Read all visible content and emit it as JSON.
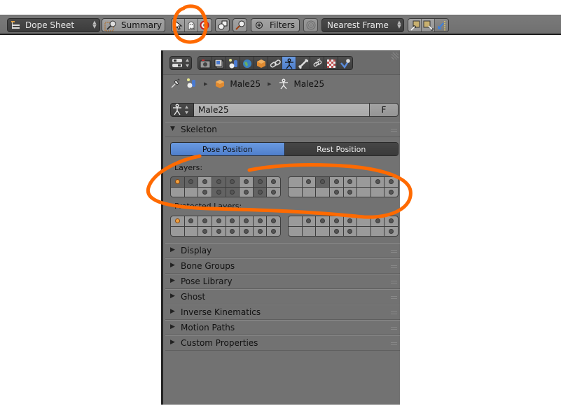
{
  "toolbar": {
    "editor_type": {
      "icon": "dopesheet-icon",
      "label": "Dope Sheet"
    },
    "summary": {
      "icon": "summary-icon",
      "label": "Summary"
    },
    "selection_modes": [
      {
        "icon": "cursor-icon",
        "active": false
      },
      {
        "icon": "ghost-icon",
        "active": false
      },
      {
        "icon": "lifebuoy-icon",
        "active": false
      }
    ],
    "only_selected_icon": "shapes-icon",
    "search_icon": "magnifier-icon",
    "filters": {
      "icon": "plus-circle-icon",
      "label": "Filters"
    },
    "proportional_icon": "proportional-icon",
    "snap": {
      "label": "Nearest Frame"
    },
    "keyframe_tools": [
      "copy-keys-icon",
      "paste-keys-icon",
      "paste-flipped-icon"
    ]
  },
  "properties": {
    "context_switch_icon": "editor-type-icon",
    "tabs": [
      {
        "icon": "render-icon",
        "active": false
      },
      {
        "icon": "render-layers-icon",
        "active": false
      },
      {
        "icon": "scene-icon",
        "active": false
      },
      {
        "icon": "world-icon",
        "active": false
      },
      {
        "icon": "object-icon",
        "active": false
      },
      {
        "icon": "constraints-icon",
        "active": false
      },
      {
        "icon": "armature-data-icon",
        "active": true
      },
      {
        "icon": "bone-icon",
        "active": false
      },
      {
        "icon": "bone-constraints-icon",
        "active": false
      },
      {
        "icon": "texture-icon",
        "active": false
      },
      {
        "icon": "physics-icon",
        "active": false
      }
    ],
    "breadcrumb": {
      "pin_icon": "pin-icon",
      "scene_icon": "scene-icon",
      "object": {
        "icon": "object-icon",
        "label": "Male25"
      },
      "armature": {
        "icon": "armature-icon",
        "label": "Male25"
      }
    },
    "armature_field": {
      "value": "Male25",
      "fake_user_label": "F"
    },
    "skeleton": {
      "title": "Skeleton",
      "expanded": true,
      "pose_position_label": "Pose Position",
      "rest_position_label": "Rest Position",
      "selected_position": "Pose Position",
      "layers_label": "Layers:",
      "protected_layers_label": "Protected Layers:",
      "layers": {
        "left": {
          "on": [
            [
              1,
              1,
              0,
              1,
              1,
              0,
              1,
              0
            ],
            [
              0,
              0,
              0,
              1,
              1,
              0,
              1,
              0
            ]
          ],
          "dots": [
            [
              2,
              1,
              1,
              1,
              1,
              1,
              1,
              1
            ],
            [
              0,
              0,
              1,
              1,
              1,
              1,
              1,
              1
            ]
          ]
        },
        "right": {
          "on": [
            [
              0,
              0,
              1,
              0,
              0,
              0,
              0,
              0
            ],
            [
              0,
              0,
              0,
              0,
              0,
              0,
              0,
              0
            ]
          ],
          "dots": [
            [
              0,
              1,
              1,
              1,
              1,
              0,
              1,
              1
            ],
            [
              0,
              0,
              0,
              1,
              1,
              0,
              0,
              1
            ]
          ]
        }
      },
      "protected_layers": {
        "left": {
          "on": [
            [
              0,
              0,
              0,
              0,
              0,
              0,
              0,
              0
            ],
            [
              0,
              0,
              0,
              0,
              0,
              0,
              0,
              0
            ]
          ],
          "dots": [
            [
              2,
              1,
              1,
              1,
              1,
              1,
              1,
              1
            ],
            [
              0,
              0,
              1,
              1,
              1,
              1,
              1,
              1
            ]
          ]
        },
        "right": {
          "on": [
            [
              0,
              0,
              0,
              0,
              0,
              0,
              0,
              0
            ],
            [
              0,
              0,
              0,
              0,
              0,
              0,
              0,
              0
            ]
          ],
          "dots": [
            [
              0,
              1,
              1,
              1,
              1,
              0,
              1,
              1
            ],
            [
              0,
              0,
              0,
              1,
              1,
              0,
              0,
              1
            ]
          ]
        }
      }
    },
    "collapsed_sections": [
      "Display",
      "Bone Groups",
      "Pose Library",
      "Ghost",
      "Inverse Kinematics",
      "Motion Paths",
      "Custom Properties"
    ]
  },
  "annotations": {
    "color": "#ff6a00",
    "items": [
      "circle-around-ghost-button",
      "ellipse-around-layers"
    ]
  },
  "colors": {
    "panel_bg": "#727272",
    "active_blue": "#5b8ad6",
    "active_layer_dot": "#f0a040"
  }
}
